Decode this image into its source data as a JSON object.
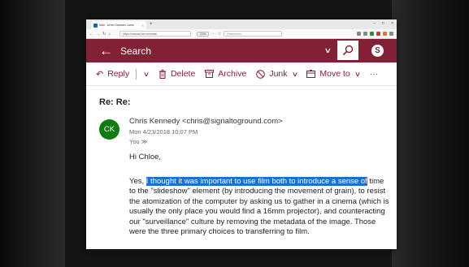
{
  "browser": {
    "tab_title": "Mail - Urbel Sanbam Lame",
    "tab_close": "×",
    "new_tab": "+",
    "url": "https://outlook.live.com/mail",
    "zoom": "133%",
    "search_placeholder": "Rechercher",
    "window_controls": [
      "–",
      "□",
      "×"
    ]
  },
  "outlook": {
    "back_glyph": "←",
    "search_label": "Search",
    "skype_glyph": "S"
  },
  "commands": {
    "reply": "Reply",
    "delete": "Delete",
    "archive": "Archive",
    "junk": "Junk",
    "move_to": "Move to",
    "more": "···"
  },
  "message": {
    "subject": "Re: Re:",
    "avatar_initials": "CK",
    "sender": "Chris Kennedy <chris@signaltoground.com>",
    "date": "Mon 4/23/2018 10:07 PM",
    "to": "You",
    "greeting": "Hi Chloe,",
    "body_prefix": "Yes, ",
    "body_selected": "I thought it was important to use film both to introduce a sense of",
    "body_rest": " time to the \"slideshow\" element (by introducing the movement of grain), to resist the atomization of the computer by asking us to gather in a cinema (which is usually the only place you would find a 16mm projector), and counteracting our \"surveillance\" culture by removing the metadata of the image. Those were the three primary choices to transferring to film."
  },
  "colors": {
    "brand": "#822036",
    "avatar": "#107c10",
    "selection": "#1a6fd2"
  }
}
